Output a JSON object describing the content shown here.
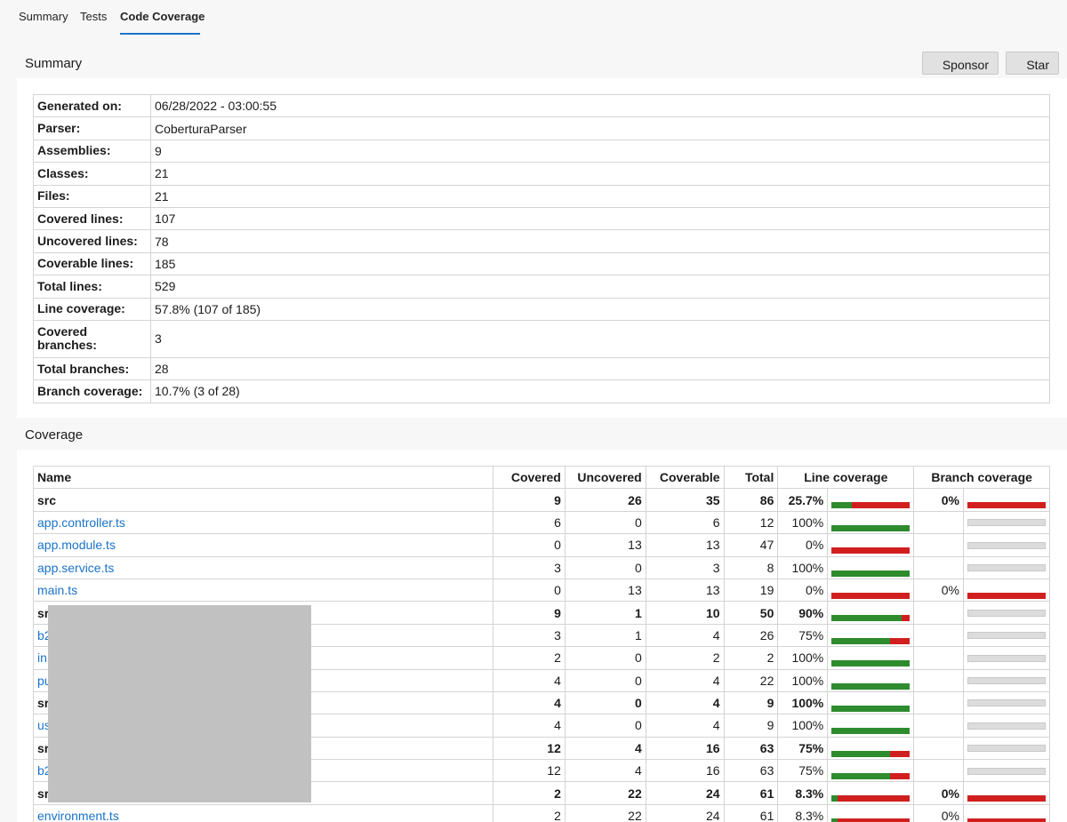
{
  "tabs": [
    {
      "label": "Summary"
    },
    {
      "label": "Tests"
    },
    {
      "label": "Code Coverage"
    }
  ],
  "summary_title": "Summary",
  "coverage_title": "Coverage",
  "buttons": {
    "sponsor": "Sponsor",
    "star": "Star"
  },
  "summary": [
    {
      "key": "Generated on:",
      "value": "06/28/2022 - 03:00:55"
    },
    {
      "key": "Parser:",
      "value": "CoberturaParser"
    },
    {
      "key": "Assemblies:",
      "value": "9"
    },
    {
      "key": "Classes:",
      "value": "21"
    },
    {
      "key": "Files:",
      "value": "21"
    },
    {
      "key": "Covered lines:",
      "value": "107"
    },
    {
      "key": "Uncovered lines:",
      "value": "78"
    },
    {
      "key": "Coverable lines:",
      "value": "185"
    },
    {
      "key": "Total lines:",
      "value": "529"
    },
    {
      "key": "Line coverage:",
      "value": "57.8% (107 of 185)"
    },
    {
      "key": "Covered branches:",
      "value": "3"
    },
    {
      "key": "Total branches:",
      "value": "28"
    },
    {
      "key": "Branch coverage:",
      "value": "10.7% (3 of 28)"
    }
  ],
  "coverage": {
    "headers": {
      "name": "Name",
      "covered": "Covered",
      "uncovered": "Uncovered",
      "coverable": "Coverable",
      "total": "Total",
      "line": "Line coverage",
      "branch": "Branch coverage"
    },
    "rows": [
      {
        "name": "src",
        "group": true,
        "covered": "9",
        "uncovered": "26",
        "coverable": "35",
        "total": "86",
        "line_pct": "25.7%",
        "line_frac": 0.257,
        "branch_pct": "0%",
        "branch_frac": 0
      },
      {
        "name": "app.controller.ts",
        "group": false,
        "covered": "6",
        "uncovered": "0",
        "coverable": "6",
        "total": "12",
        "line_pct": "100%",
        "line_frac": 1,
        "branch_pct": "",
        "branch_frac": null
      },
      {
        "name": "app.module.ts",
        "group": false,
        "covered": "0",
        "uncovered": "13",
        "coverable": "13",
        "total": "47",
        "line_pct": "0%",
        "line_frac": 0,
        "branch_pct": "",
        "branch_frac": null
      },
      {
        "name": "app.service.ts",
        "group": false,
        "covered": "3",
        "uncovered": "0",
        "coverable": "3",
        "total": "8",
        "line_pct": "100%",
        "line_frac": 1,
        "branch_pct": "",
        "branch_frac": null
      },
      {
        "name": "main.ts",
        "group": false,
        "covered": "0",
        "uncovered": "13",
        "coverable": "13",
        "total": "19",
        "line_pct": "0%",
        "line_frac": 0,
        "branch_pct": "0%",
        "branch_frac": 0
      },
      {
        "name": "sr",
        "group": true,
        "covered": "9",
        "uncovered": "1",
        "coverable": "10",
        "total": "50",
        "line_pct": "90%",
        "line_frac": 0.9,
        "branch_pct": "",
        "branch_frac": null
      },
      {
        "name": "b2",
        "group": false,
        "covered": "3",
        "uncovered": "1",
        "coverable": "4",
        "total": "26",
        "line_pct": "75%",
        "line_frac": 0.75,
        "branch_pct": "",
        "branch_frac": null
      },
      {
        "name": "in",
        "group": false,
        "covered": "2",
        "uncovered": "0",
        "coverable": "2",
        "total": "2",
        "line_pct": "100%",
        "line_frac": 1,
        "branch_pct": "",
        "branch_frac": null
      },
      {
        "name": "pu",
        "group": false,
        "covered": "4",
        "uncovered": "0",
        "coverable": "4",
        "total": "22",
        "line_pct": "100%",
        "line_frac": 1,
        "branch_pct": "",
        "branch_frac": null
      },
      {
        "name": "sr",
        "group": true,
        "covered": "4",
        "uncovered": "0",
        "coverable": "4",
        "total": "9",
        "line_pct": "100%",
        "line_frac": 1,
        "branch_pct": "",
        "branch_frac": null
      },
      {
        "name": "us",
        "group": false,
        "covered": "4",
        "uncovered": "0",
        "coverable": "4",
        "total": "9",
        "line_pct": "100%",
        "line_frac": 1,
        "branch_pct": "",
        "branch_frac": null
      },
      {
        "name": "sr",
        "group": true,
        "covered": "12",
        "uncovered": "4",
        "coverable": "16",
        "total": "63",
        "line_pct": "75%",
        "line_frac": 0.75,
        "branch_pct": "",
        "branch_frac": null
      },
      {
        "name": "b2",
        "group": false,
        "covered": "12",
        "uncovered": "4",
        "coverable": "16",
        "total": "63",
        "line_pct": "75%",
        "line_frac": 0.75,
        "branch_pct": "",
        "branch_frac": null
      },
      {
        "name": "sr",
        "group": true,
        "covered": "2",
        "uncovered": "22",
        "coverable": "24",
        "total": "61",
        "line_pct": "8.3%",
        "line_frac": 0.083,
        "branch_pct": "0%",
        "branch_frac": 0
      },
      {
        "name": "environment.ts",
        "group": false,
        "covered": "2",
        "uncovered": "22",
        "coverable": "24",
        "total": "61",
        "line_pct": "8.3%",
        "line_frac": 0.083,
        "branch_pct": "0%",
        "branch_frac": 0
      }
    ]
  },
  "colors": {
    "accent": "#1a73c9",
    "covered": "#2e8b2e",
    "uncovered": "#d11f1f",
    "empty": "#dcdcdc"
  }
}
